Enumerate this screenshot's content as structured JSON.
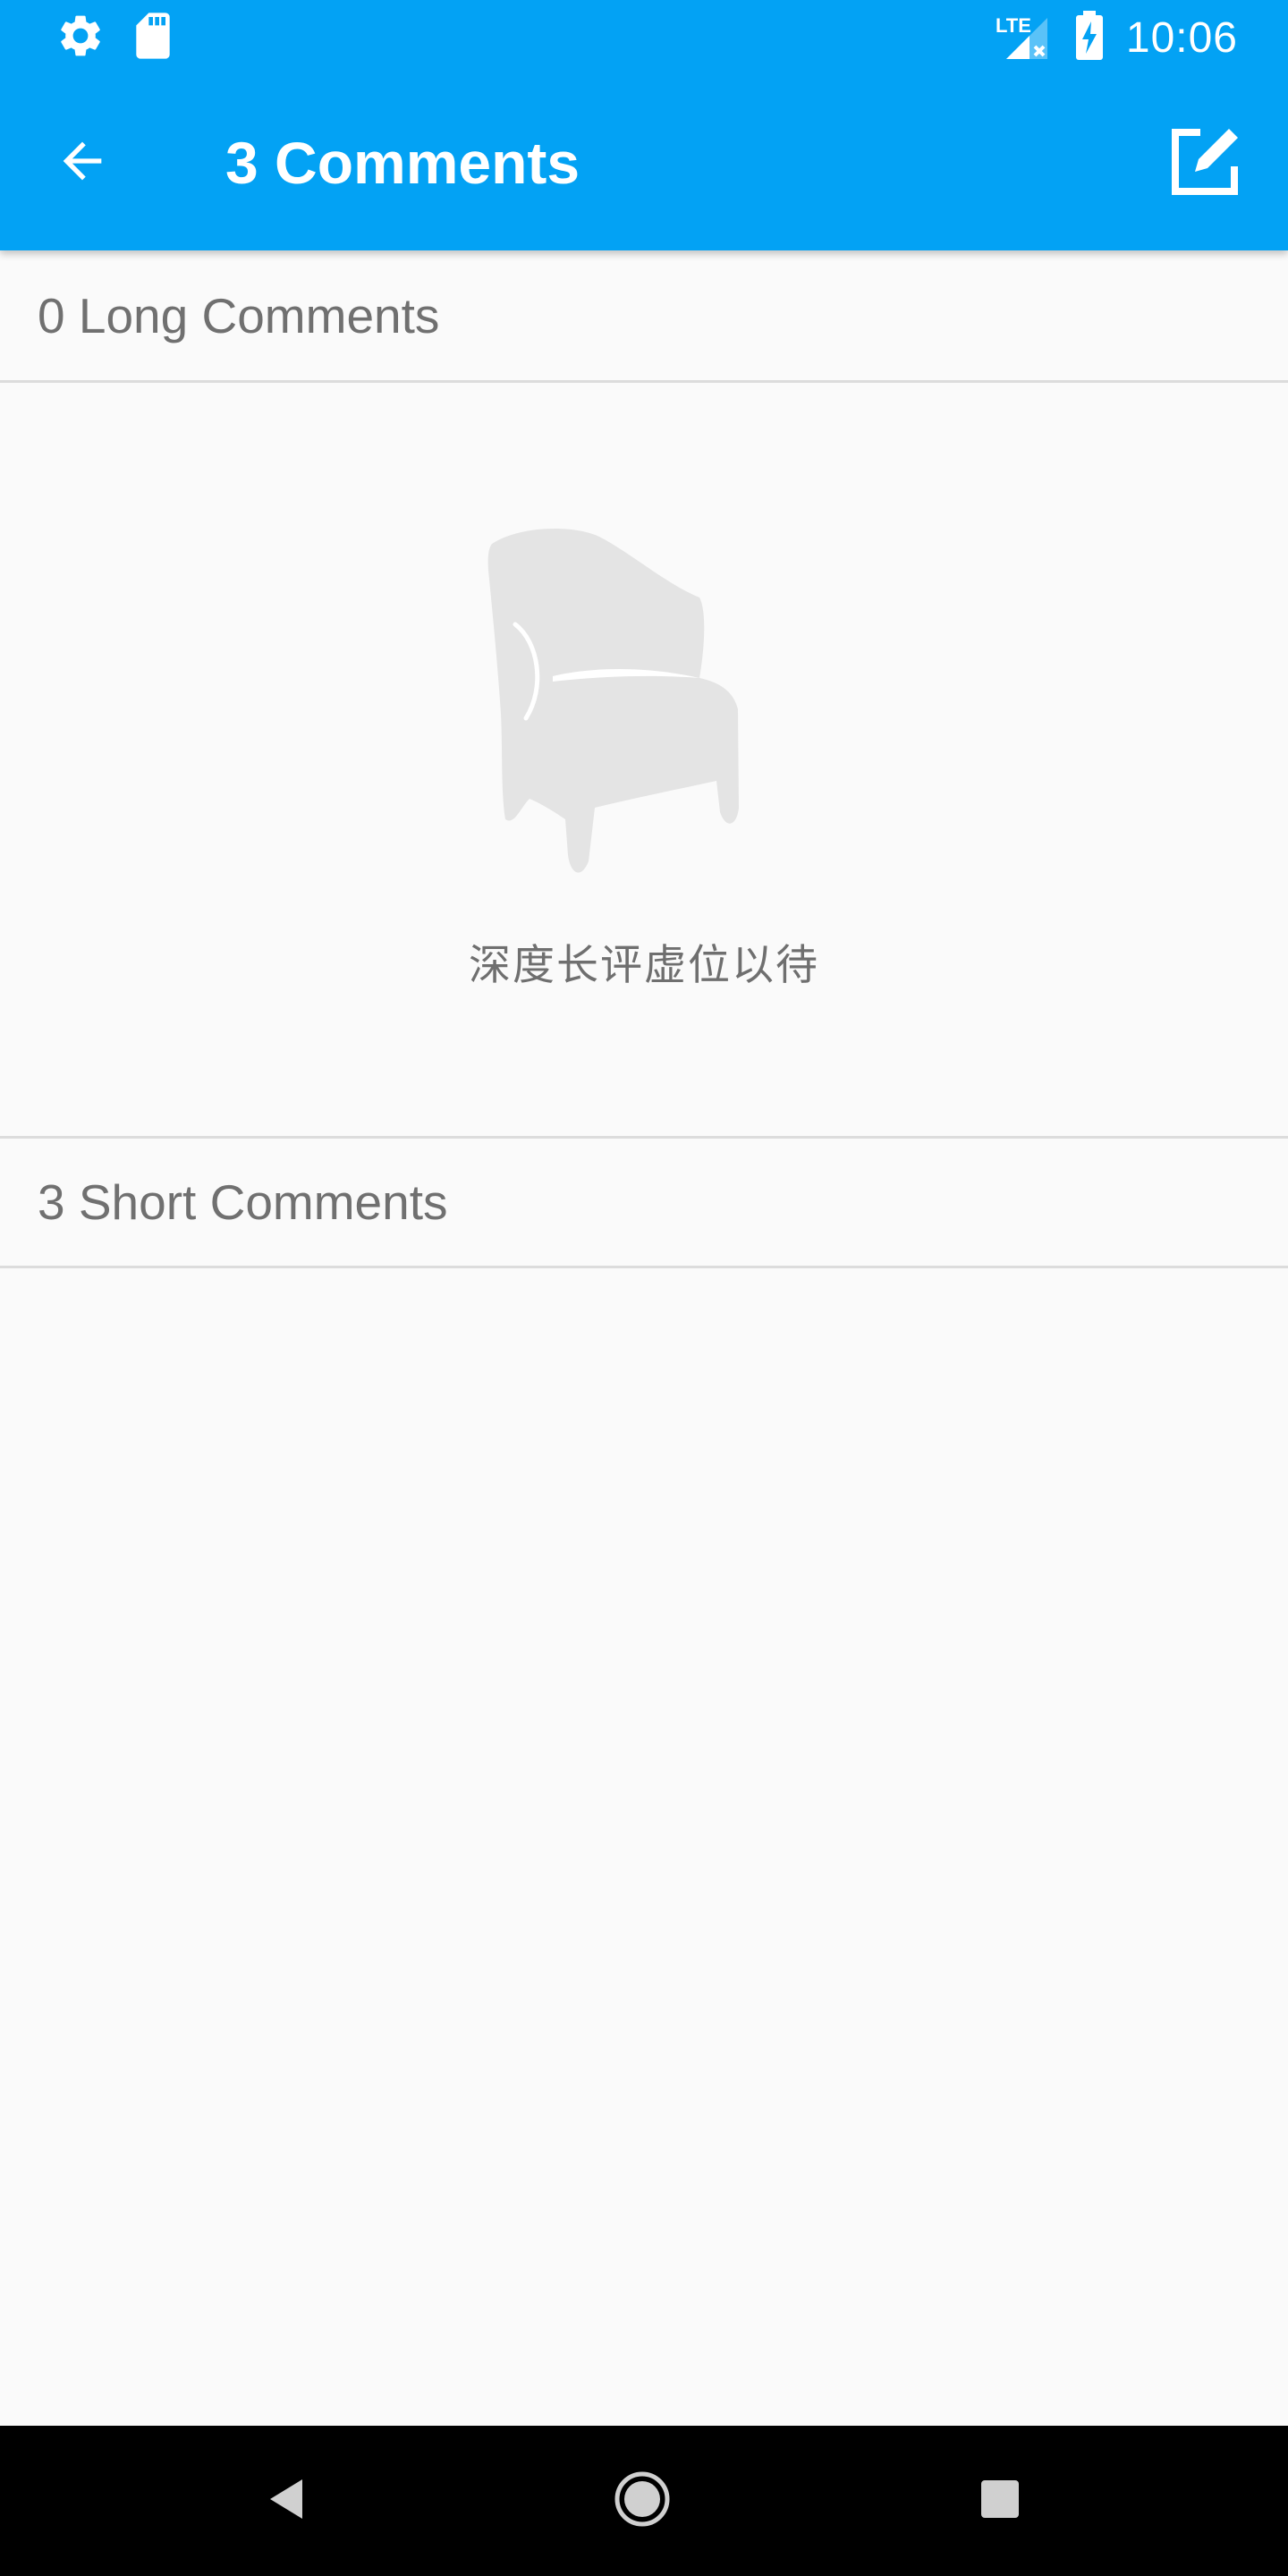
{
  "status_bar": {
    "time": "10:06",
    "network_label": "LTE",
    "icons": [
      "settings-icon",
      "sd-card-icon",
      "lte-signal-icon",
      "battery-charging-icon"
    ]
  },
  "toolbar": {
    "title": "3 Comments",
    "back_icon": "arrow-back-icon",
    "compose_icon": "edit-icon"
  },
  "long_comments": {
    "header": "0 Long Comments",
    "empty_icon": "armchair-icon",
    "empty_text": "深度长评虚位以待"
  },
  "short_comments": {
    "header": "3 Short Comments",
    "items": []
  },
  "nav_bar": {
    "icons": [
      "nav-back-icon",
      "nav-home-icon",
      "nav-recents-icon"
    ]
  },
  "colors": {
    "primary": "#03a2f4",
    "background": "#fafafa",
    "header_text": "#707070",
    "divider": "#dcdcdc",
    "empty_icon": "#e4e4e4"
  }
}
